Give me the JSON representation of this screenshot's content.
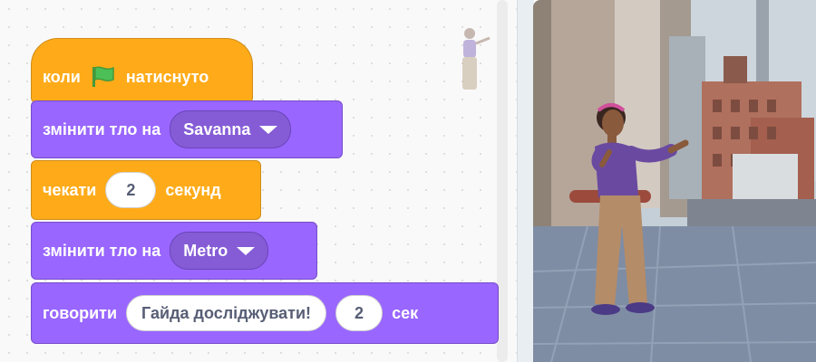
{
  "script": {
    "hat": {
      "before": "коли",
      "flag_icon": "green-flag-icon",
      "after": "натиснуто"
    },
    "switch1": {
      "label": "змінити тло на",
      "value": "Savanna"
    },
    "wait": {
      "label": "чекати",
      "value": "2",
      "unit": "секунд"
    },
    "switch2": {
      "label": "змінити тло на",
      "value": "Metro"
    },
    "say": {
      "label": "говорити",
      "message": "Гайда досліджувати!",
      "secs": "2",
      "unit": "сек"
    }
  },
  "colors": {
    "events": "#ffab19",
    "looks": "#9966ff",
    "looks_dropdown": "#855cd6",
    "control": "#ffab19",
    "flag": "#4cbf56"
  }
}
